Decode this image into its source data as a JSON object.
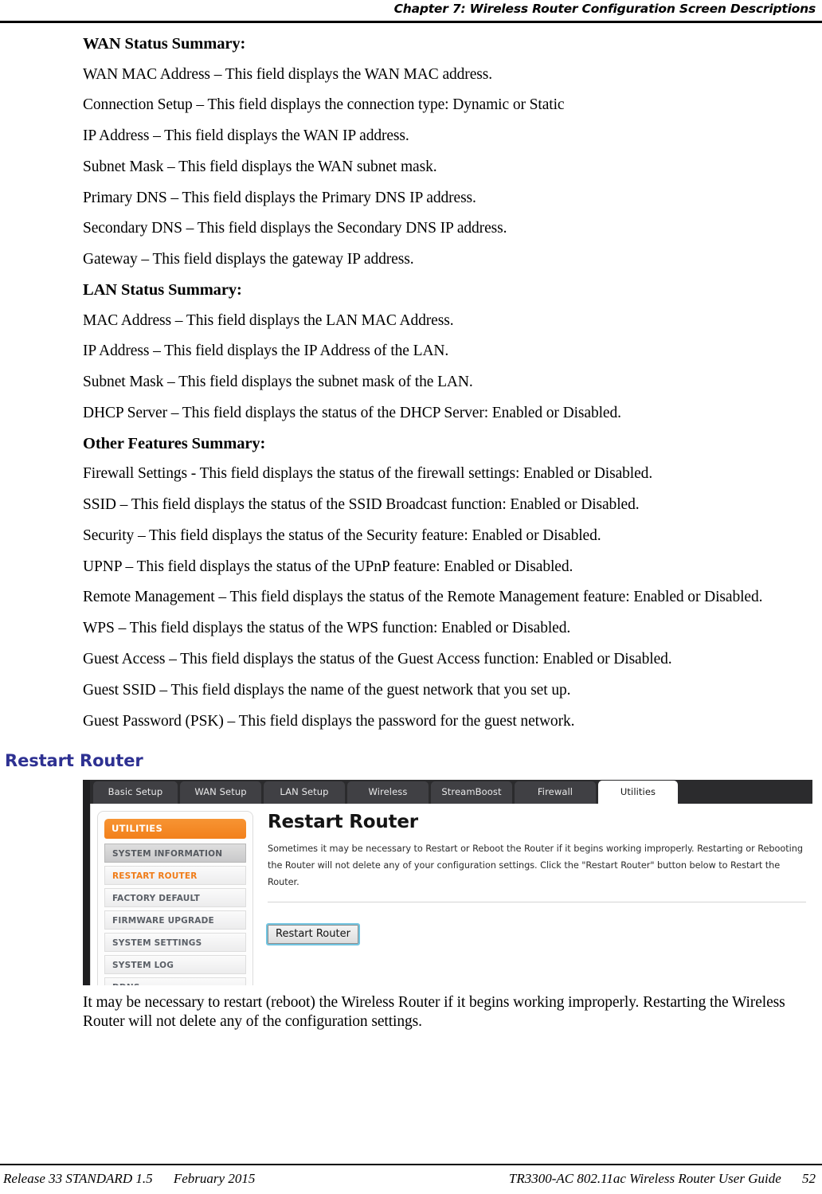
{
  "header": {
    "chapter_label": "Chapter 7: Wireless Router Configuration Screen Descriptions"
  },
  "body": {
    "wan_heading": "WAN Status Summary:",
    "wan_items": [
      "WAN MAC Address – This field displays the WAN MAC address.",
      "Connection Setup – This field displays the connection type: Dynamic or Static",
      "IP Address – This field displays the WAN IP address.",
      "Subnet Mask – This field displays the WAN subnet mask.",
      "Primary DNS – This field displays the Primary DNS IP address.",
      "Secondary DNS – This field displays the Secondary DNS IP address.",
      "Gateway – This field displays the gateway IP address."
    ],
    "lan_heading": "LAN Status Summary:",
    "lan_items": [
      "MAC Address – This field displays the LAN MAC Address.",
      "IP Address – This field displays the IP Address of the LAN.",
      "Subnet Mask – This field displays the subnet mask of the LAN.",
      "DHCP Server – This field displays the status of the DHCP Server: Enabled or Disabled."
    ],
    "other_heading": "Other Features Summary:",
    "other_items": [
      "Firewall Settings - This field displays the status of the firewall settings: Enabled or Disabled.",
      "SSID – This field displays the status of the SSID Broadcast function: Enabled or Disabled.",
      "Security – This field displays the status of the Security feature: Enabled or Disabled.",
      "UPNP – This field displays the status of the UPnP feature: Enabled or Disabled.",
      "Remote Management – This field displays the status of the Remote Management feature: Enabled or Disabled.",
      "WPS – This field displays the status of the WPS function: Enabled or Disabled.",
      "Guest Access – This field displays the status of the Guest Access function: Enabled or Disabled.",
      "Guest SSID – This field displays the name of the guest network that you set up.",
      "Guest Password (PSK) – This field displays the password for the guest network."
    ],
    "section_heading": "Restart Router",
    "closing_paragraph": "It may be necessary to restart (reboot) the Wireless Router if it begins working improperly. Restarting the Wireless Router will not delete any of the configuration settings."
  },
  "screenshot": {
    "tabs": [
      {
        "label": "Basic Setup",
        "active": false
      },
      {
        "label": "WAN Setup",
        "active": false
      },
      {
        "label": "LAN Setup",
        "active": false
      },
      {
        "label": "Wireless",
        "active": false
      },
      {
        "label": "StreamBoost",
        "active": false
      },
      {
        "label": "Firewall",
        "active": false
      },
      {
        "label": "Utilities",
        "active": true
      }
    ],
    "sidebar": {
      "title": "UTILITIES",
      "items": [
        {
          "label": "SYSTEM INFORMATION",
          "state": "sel"
        },
        {
          "label": "RESTART ROUTER",
          "state": "cur"
        },
        {
          "label": "FACTORY DEFAULT",
          "state": ""
        },
        {
          "label": "FIRMWARE UPGRADE",
          "state": ""
        },
        {
          "label": "SYSTEM SETTINGS",
          "state": ""
        },
        {
          "label": "SYSTEM LOG",
          "state": ""
        },
        {
          "label": "DDNS",
          "state": ""
        }
      ]
    },
    "panel": {
      "title": "Restart Router",
      "description": "Sometimes it may be necessary to Restart or Reboot the Router if it begins working improperly. Restarting or Rebooting the Router will not delete any of your configuration settings. Click the \"Restart Router\" button below to Restart the Router.",
      "button_label": "Restart Router"
    },
    "accent_orange": "#f2801b",
    "tab_dark": "#2b2b2d"
  },
  "footer": {
    "release": "Release 33 STANDARD 1.5",
    "date": "February 2015",
    "guide": "TR3300-AC 802.11ac Wireless Router User Guide",
    "page_number": "52"
  }
}
